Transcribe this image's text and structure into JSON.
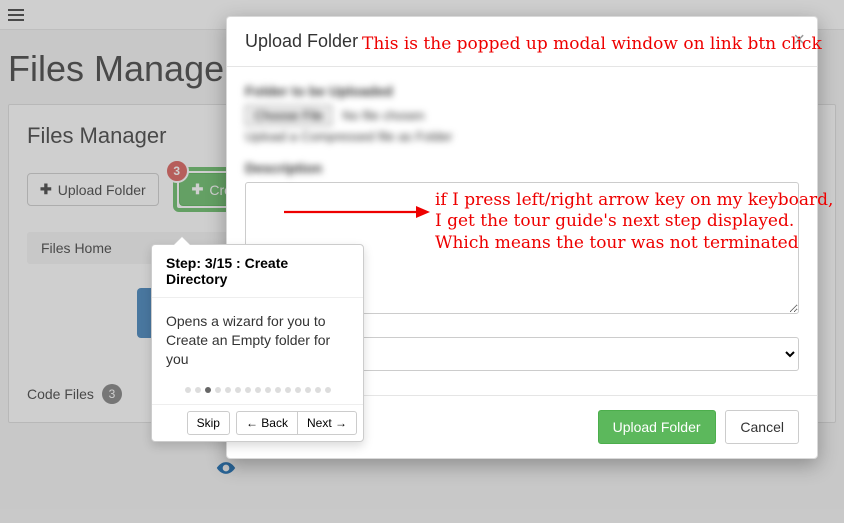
{
  "header": {
    "page_title": "Files Manager"
  },
  "panel": {
    "title": "Files Manager"
  },
  "toolbar": {
    "upload_label": "Upload Folder",
    "create_label": "Create Folder",
    "step_badge": "3"
  },
  "breadcrumb": {
    "home": "Files Home"
  },
  "codefiles": {
    "label": "Code Files",
    "count": "3"
  },
  "tour": {
    "title": "Step: 3/15 : Create Directory",
    "body": "Opens a wizard for you to Create an Empty folder for you",
    "skip": "Skip",
    "back": "← Back",
    "next": "Next →",
    "active_dot_index": 2,
    "total_dots": 15
  },
  "modal": {
    "title": "Upload Folder",
    "label_folder": "Folder to be Uploaded",
    "choose_file": "Choose File",
    "no_file": "No file chosen",
    "helper": "Upload a Compressed file as Folder",
    "label_desc": "Description",
    "submit": "Upload Folder",
    "cancel": "Cancel"
  },
  "annotations": {
    "top": "This is the popped up modal window on link btn click",
    "side": "if I press left/right arrow key on my keyboard,\nI get the tour guide's next step displayed.\nWhich means the tour was not terminated"
  }
}
